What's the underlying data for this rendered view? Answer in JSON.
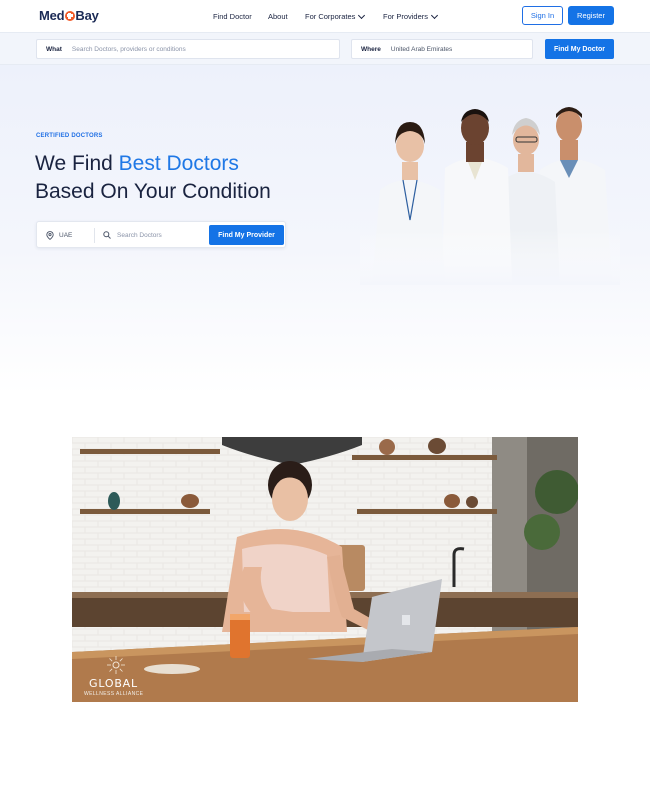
{
  "nav": {
    "logo_left": "Med",
    "logo_right": "Bay",
    "links": [
      {
        "label": "Find Doctor",
        "dropdown": false
      },
      {
        "label": "About",
        "dropdown": false
      },
      {
        "label": "For Corporates",
        "dropdown": true
      },
      {
        "label": "For Providers",
        "dropdown": true
      }
    ],
    "sign_in": "Sign In",
    "register": "Register"
  },
  "search_strip": {
    "what_label": "What",
    "what_placeholder": "Search Doctors, providers or conditions",
    "where_label": "Where",
    "where_value": "United Arab Emirates",
    "button": "Find My Doctor"
  },
  "hero": {
    "eyebrow": "CERTIFIED DOCTORS",
    "title_part1": "We Find ",
    "title_accent": "Best Doctors",
    "title_line2": "Based On Your Condition",
    "location": "UAE",
    "search_placeholder": "Search Doctors",
    "button": "Find My Provider"
  },
  "photo": {
    "brand_line1": "GLOBAL",
    "brand_line2": "WELLNESS ALLIANCE"
  },
  "colors": {
    "primary": "#1473e6",
    "accent_text": "#1f78e6",
    "dark_text": "#1a2340",
    "logo_dot": "#f05a28"
  }
}
